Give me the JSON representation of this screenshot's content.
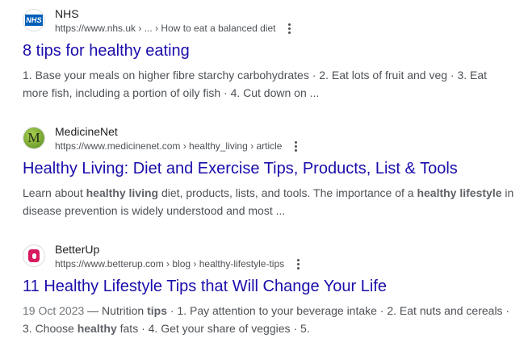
{
  "results": [
    {
      "site_name": "NHS",
      "favicon_text": "NHS",
      "url": "https://www.nhs.uk › ... › How to eat a balanced diet",
      "title": "8 tips for healthy eating",
      "snippet": [
        {
          "t": "1. Base your meals on higher fibre starchy carbohydrates · 2. Eat lots of fruit and veg · 3. Eat more fish, including a portion of oily fish · 4. Cut down on ..."
        }
      ]
    },
    {
      "site_name": "MedicineNet",
      "favicon_text": "M",
      "url": "https://www.medicinenet.com › healthy_living › article",
      "title": "Healthy Living: Diet and Exercise Tips, Products, List & Tools",
      "snippet": [
        {
          "t": "Learn about "
        },
        {
          "t": "healthy living",
          "b": true
        },
        {
          "t": " diet, products, lists, and tools. The importance of a "
        },
        {
          "t": "healthy lifestyle",
          "b": true
        },
        {
          "t": " in disease prevention is widely understood and most ..."
        }
      ]
    },
    {
      "site_name": "BetterUp",
      "favicon_text": "",
      "url": "https://www.betterup.com › blog › healthy-lifestyle-tips",
      "title": "11 Healthy Lifestyle Tips that Will Change Your Life",
      "snippet": [
        {
          "t": "19 Oct 2023",
          "date": true
        },
        {
          "t": " — Nutrition "
        },
        {
          "t": "tips",
          "b": true
        },
        {
          "t": " · 1. Pay attention to your beverage intake · 2. Eat nuts and cereals · 3. Choose "
        },
        {
          "t": "healthy",
          "b": true
        },
        {
          "t": " fats · 4. Get your share of veggies · 5."
        }
      ]
    }
  ],
  "colors": {
    "title_link": "#1a0dab",
    "snippet_text": "#4d5156",
    "nhs_blue": "#005eb8",
    "medicinenet_green": "#7fb03a",
    "betterup_pink": "#d81b60"
  },
  "icons": {
    "more_options": "kebab-vertical-icon"
  }
}
